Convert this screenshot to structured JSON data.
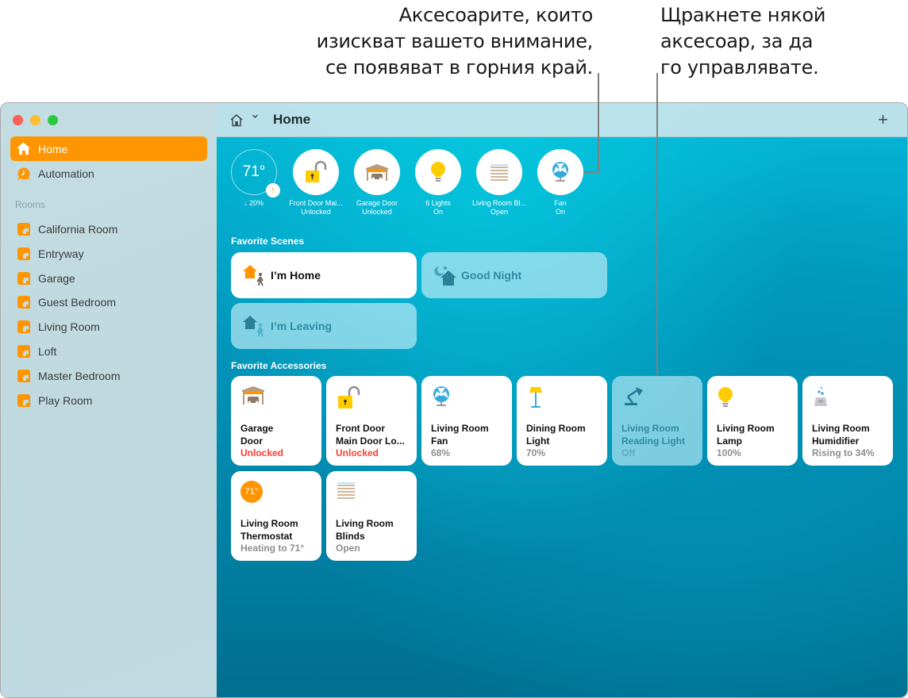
{
  "callouts": {
    "left": [
      "Аксесоарите, които",
      "изискват вашето внимание,",
      "се появяват в горния край."
    ],
    "right": [
      "Щракнете някой",
      "аксесоар, за да",
      "го управлявате."
    ]
  },
  "window": {
    "traffic_lights": [
      "close",
      "minimize",
      "zoom"
    ]
  },
  "sidebar": {
    "nav": [
      {
        "label": "Home",
        "icon": "house-icon",
        "active": true
      },
      {
        "label": "Automation",
        "icon": "clock-icon",
        "active": false
      }
    ],
    "rooms_heading": "Rooms",
    "rooms": [
      "California Room",
      "Entryway",
      "Garage",
      "Guest Bedroom",
      "Living Room",
      "Loft",
      "Master Bedroom",
      "Play Room"
    ]
  },
  "toolbar": {
    "title": "Home",
    "home_icon": "house-outline-icon",
    "chevron": "⌄",
    "add_label": "+"
  },
  "status": {
    "temperature": "71°",
    "temp_trend": "↑",
    "humidity": "20%",
    "items": [
      {
        "name": "Front Door Mai...",
        "state": "Unlocked",
        "icon": "padlock-open-icon"
      },
      {
        "name": "Garage Door",
        "state": "Unlocked",
        "icon": "garage-icon"
      },
      {
        "name": "6 Lights",
        "state": "On",
        "icon": "lightbulb-icon"
      },
      {
        "name": "Living Room Bl...",
        "state": "Open",
        "icon": "blinds-icon"
      },
      {
        "name": "Fan",
        "state": "On",
        "icon": "fan-icon"
      }
    ]
  },
  "scenes": {
    "title": "Favorite Scenes",
    "items": [
      {
        "label": "I’m Home",
        "active": true,
        "icon": "arrive-home-icon"
      },
      {
        "label": "Good Night",
        "active": false,
        "icon": "night-house-icon"
      },
      {
        "label": "I’m Leaving",
        "active": false,
        "icon": "leave-home-icon"
      }
    ]
  },
  "accessories": {
    "title": "Favorite Accessories",
    "items": [
      {
        "name": [
          "Garage",
          "Door"
        ],
        "status": "Unlocked",
        "alert": true,
        "on": true,
        "icon": "garage-icon"
      },
      {
        "name": [
          "Front Door",
          "Main Door Lo..."
        ],
        "status": "Unlocked",
        "alert": true,
        "on": true,
        "icon": "padlock-open-icon"
      },
      {
        "name": [
          "Living Room",
          "Fan"
        ],
        "status": "68%",
        "alert": false,
        "on": true,
        "icon": "fan-icon"
      },
      {
        "name": [
          "Dining Room",
          "Light"
        ],
        "status": "70%",
        "alert": false,
        "on": true,
        "icon": "floor-lamp-icon"
      },
      {
        "name": [
          "Living Room",
          "Reading Light"
        ],
        "status": "Off",
        "alert": false,
        "on": false,
        "icon": "desk-lamp-icon"
      },
      {
        "name": [
          "Living Room",
          "Lamp"
        ],
        "status": "100%",
        "alert": false,
        "on": true,
        "icon": "lightbulb-icon"
      },
      {
        "name": [
          "Living Room",
          "Humidifier"
        ],
        "status": "Rising to 34%",
        "alert": false,
        "on": true,
        "icon": "humidifier-icon"
      },
      {
        "name": [
          "Living Room",
          "Thermostat"
        ],
        "status": "Heating to 71°",
        "alert": false,
        "on": true,
        "icon": "thermostat-icon",
        "badge": "71°"
      },
      {
        "name": [
          "Living Room",
          "Blinds"
        ],
        "status": "Open",
        "alert": false,
        "on": true,
        "icon": "blinds-icon"
      }
    ]
  },
  "colors": {
    "accent": "#ff9500",
    "alert": "#ff3b30",
    "bulb": "#ffcc00",
    "fan": "#34aadc"
  }
}
